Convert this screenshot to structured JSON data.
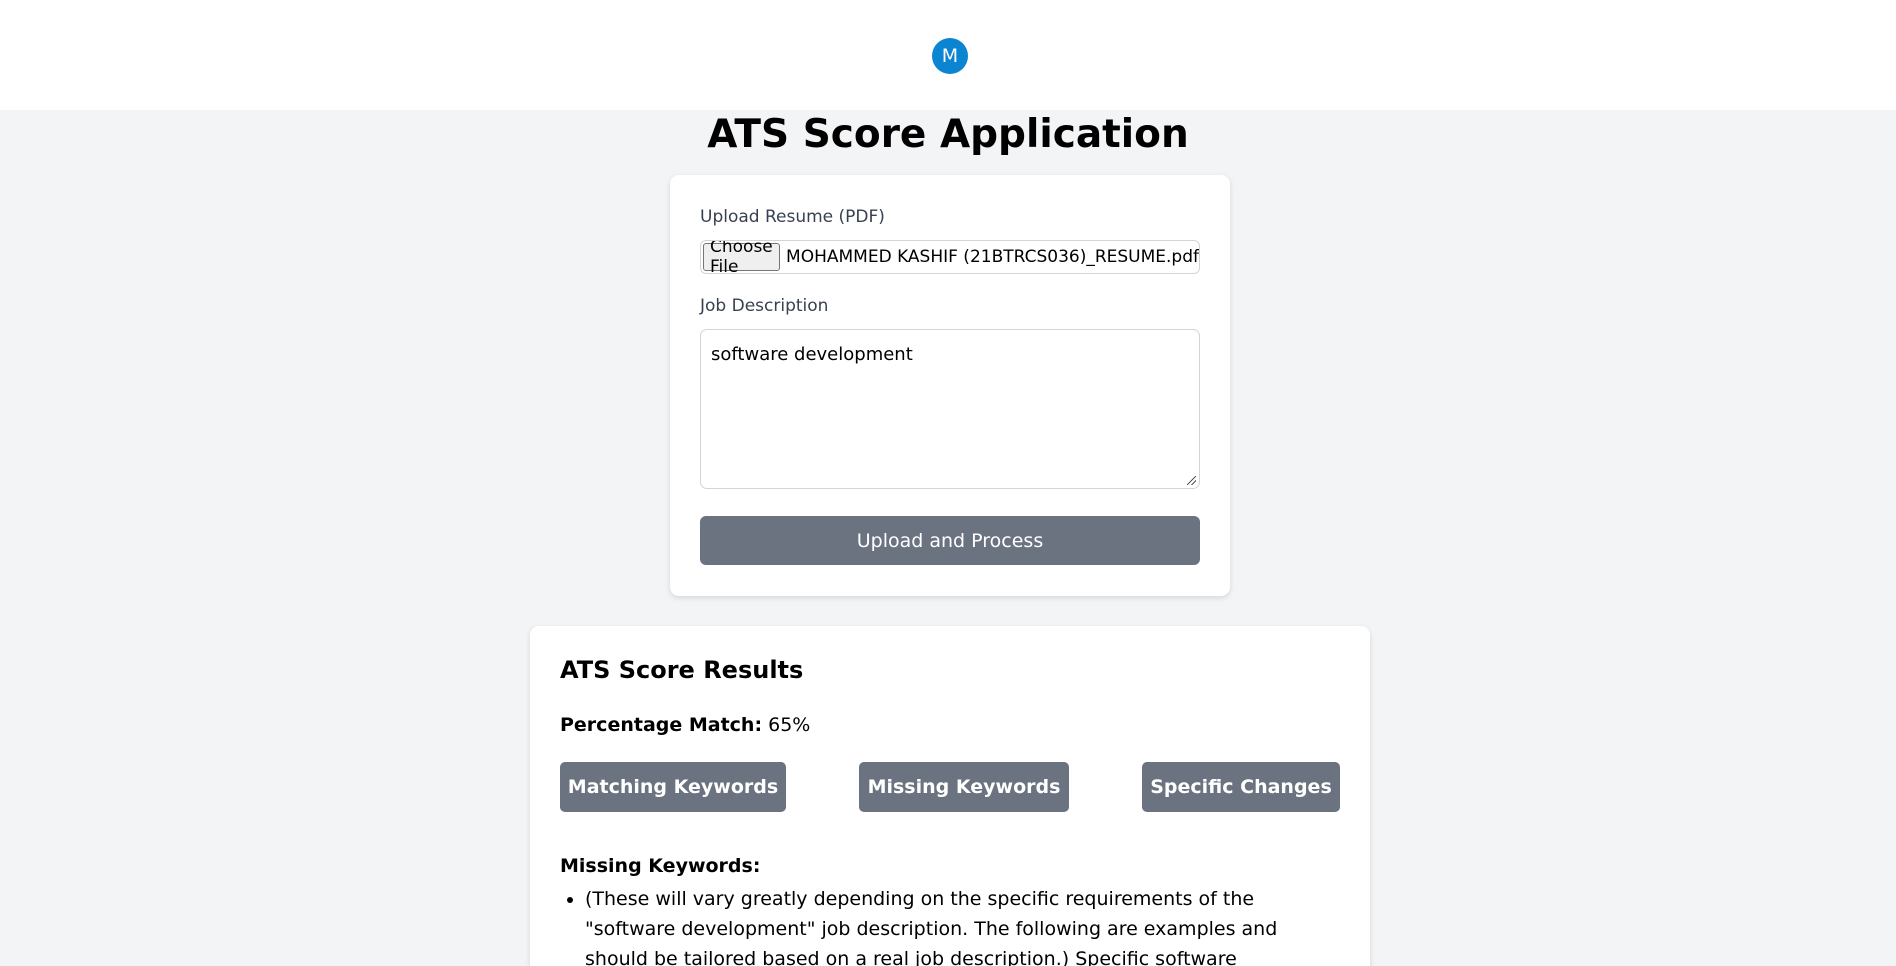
{
  "header": {
    "avatar_initial": "M"
  },
  "app": {
    "title": "ATS Score Application"
  },
  "upload_form": {
    "resume_label": "Upload Resume (PDF)",
    "choose_file_label": "Choose File",
    "file_name": "MOHAMMED KASHIF (21BTRCS036)_RESUME.pdf",
    "job_description_label": "Job Description",
    "job_description_value": "software development",
    "submit_label": "Upload and Process"
  },
  "results": {
    "title": "ATS Score Results",
    "match_label": "Percentage Match:",
    "match_value": "65%",
    "tabs": [
      "Matching Keywords",
      "Missing Keywords",
      "Specific Changes"
    ],
    "section_heading": "Missing Keywords:",
    "items": [
      "(These will vary greatly depending on the specific requirements of the \"software development\" job description. The following are examples and should be tailored based on a real job description.) Specific software development methodologies (Agile"
    ]
  },
  "colors": {
    "avatar": "#0b84d1",
    "button": "#6b7280",
    "page_bg": "#f3f4f6"
  }
}
